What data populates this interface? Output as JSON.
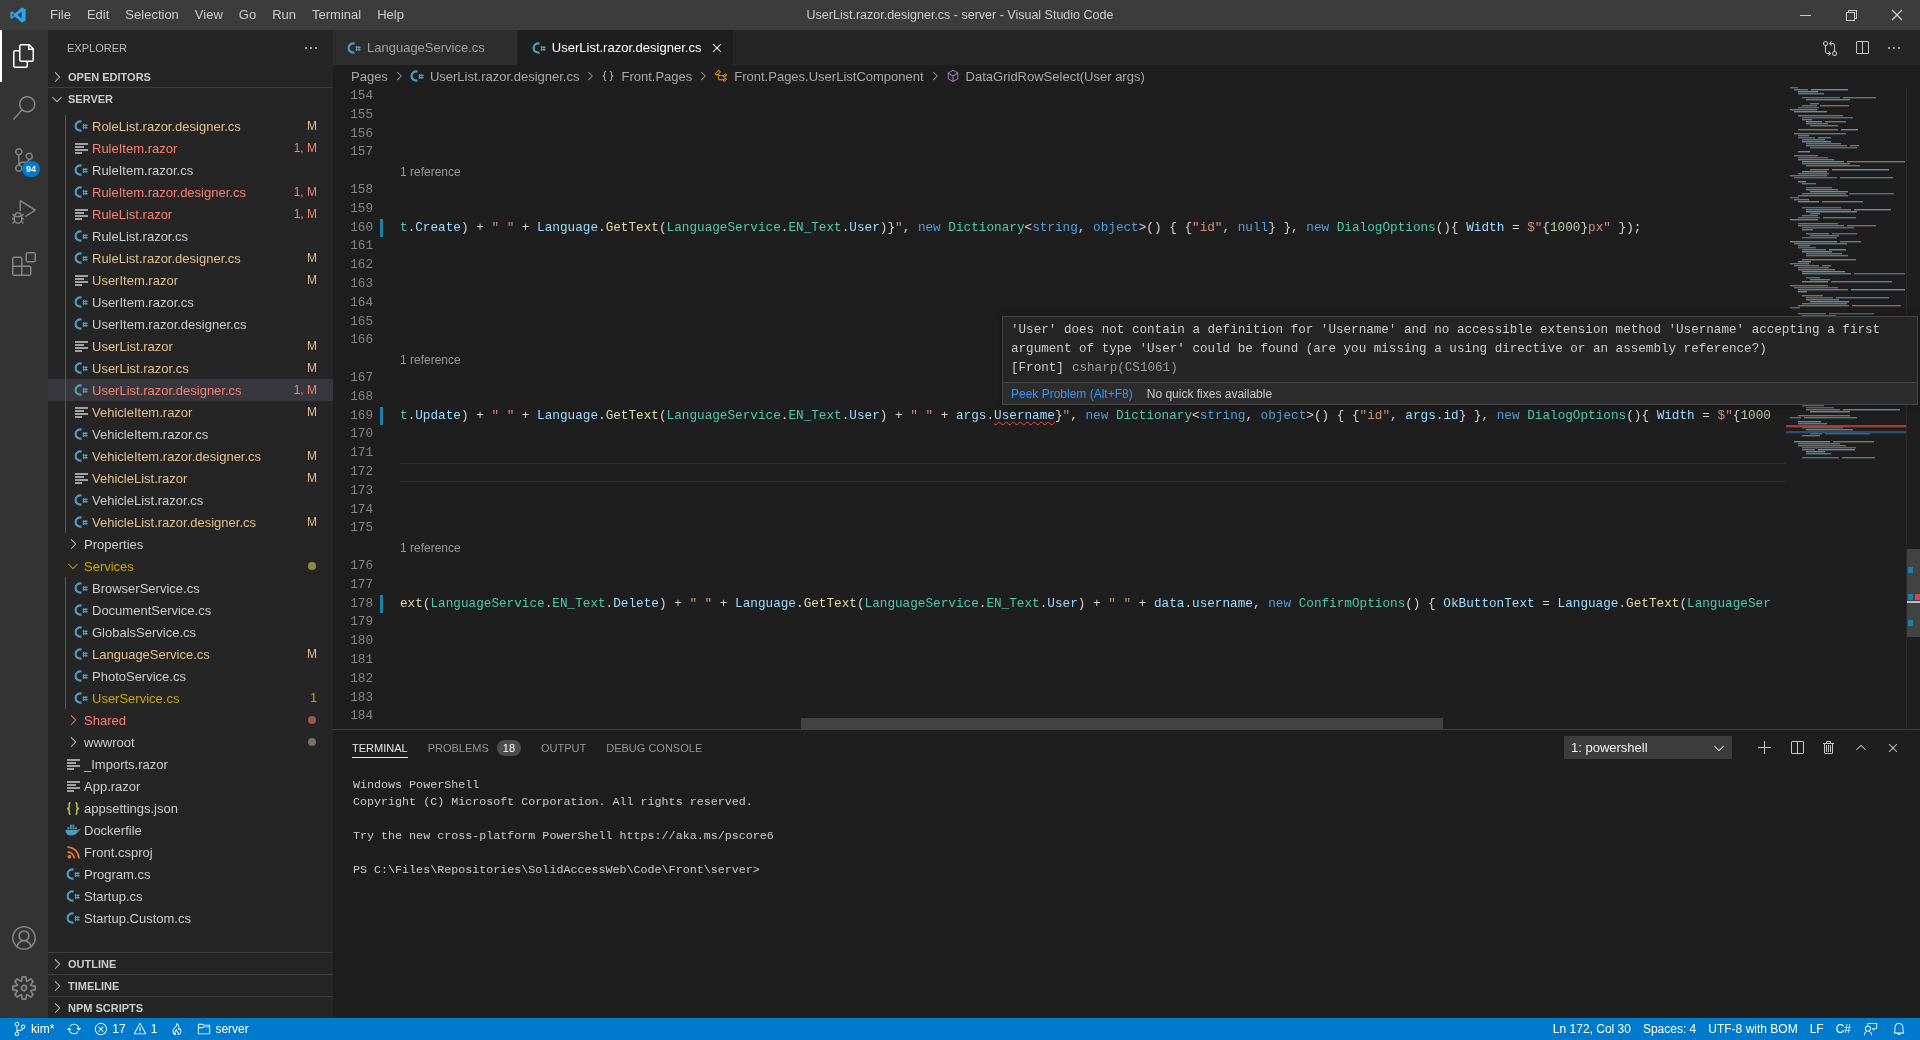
{
  "window": {
    "title": "UserList.razor.designer.cs - server - Visual Studio Code",
    "menu": [
      "File",
      "Edit",
      "Selection",
      "View",
      "Go",
      "Run",
      "Terminal",
      "Help"
    ]
  },
  "activity_bar": {
    "items": [
      {
        "kind": "explorer",
        "selected": true
      },
      {
        "kind": "search",
        "selected": false
      },
      {
        "kind": "source-control",
        "selected": false,
        "badge": "94"
      },
      {
        "kind": "run",
        "selected": false
      },
      {
        "kind": "extensions",
        "selected": false
      }
    ]
  },
  "sidebar": {
    "title": "EXPLORER",
    "sections": [
      {
        "title": "OPEN EDITORS",
        "expanded": false
      },
      {
        "title": "SERVER",
        "expanded": true,
        "tree": [
          {
            "children": [
              {
                "name": "RoleList.razor.designer.cs",
                "kind": "cs",
                "color": "#e2c08d",
                "badge": "M",
                "selected": false
              },
              {
                "name": "RuleItem.razor",
                "kind": "razor",
                "color": "#f88070",
                "badge": "1, M",
                "selected": false
              },
              {
                "name": "RuleItem.razor.cs",
                "kind": "cs",
                "color": "#cccccc",
                "selected": false
              },
              {
                "name": "RuleItem.razor.designer.cs",
                "kind": "cs",
                "color": "#f88070",
                "badge": "1, M",
                "selected": false
              },
              {
                "name": "RuleList.razor",
                "kind": "razor",
                "color": "#f88070",
                "badge": "1, M",
                "selected": false
              },
              {
                "name": "RuleList.razor.cs",
                "kind": "cs",
                "color": "#cccccc",
                "selected": false
              },
              {
                "name": "RuleList.razor.designer.cs",
                "kind": "cs",
                "color": "#e2c08d",
                "badge": "M",
                "selected": false
              },
              {
                "name": "UserItem.razor",
                "kind": "razor",
                "color": "#e2c08d",
                "badge": "M",
                "selected": false
              },
              {
                "name": "UserItem.razor.cs",
                "kind": "cs",
                "color": "#cccccc",
                "selected": false
              },
              {
                "name": "UserItem.razor.designer.cs",
                "kind": "cs",
                "color": "#cccccc",
                "selected": false
              },
              {
                "name": "UserList.razor",
                "kind": "razor",
                "color": "#e2c08d",
                "badge": "M",
                "selected": false
              },
              {
                "name": "UserList.razor.cs",
                "kind": "cs",
                "color": "#e2c08d",
                "badge": "M",
                "selected": false
              },
              {
                "name": "UserList.razor.designer.cs",
                "kind": "cs",
                "color": "#f88070",
                "badge": "1, M",
                "selected": true
              },
              {
                "name": "VehicleItem.razor",
                "kind": "razor",
                "color": "#e2c08d",
                "badge": "M",
                "selected": false
              },
              {
                "name": "VehicleItem.razor.cs",
                "kind": "cs",
                "color": "#cccccc",
                "selected": false
              },
              {
                "name": "VehicleItem.razor.designer.cs",
                "kind": "cs",
                "color": "#e2c08d",
                "badge": "M",
                "selected": false
              },
              {
                "name": "VehicleList.razor",
                "kind": "razor",
                "color": "#e2c08d",
                "badge": "M",
                "selected": false
              },
              {
                "name": "VehicleList.razor.cs",
                "kind": "cs",
                "color": "#cccccc",
                "selected": false
              },
              {
                "name": "VehicleList.razor.designer.cs",
                "kind": "cs",
                "color": "#e2c08d",
                "badge": "M",
                "selected": false
              }
            ]
          },
          {
            "name": "Properties",
            "kind": "folder",
            "expanded": false,
            "color": "#cccccc",
            "selected": false
          },
          {
            "name": "Services",
            "kind": "folder",
            "expanded": true,
            "color": "#cca700",
            "dot": {
              "color": "#8f8a3c"
            },
            "selected": false,
            "children": [
              {
                "name": "BrowserService.cs",
                "kind": "cs",
                "color": "#cccccc",
                "selected": false
              },
              {
                "name": "DocumentService.cs",
                "kind": "cs",
                "color": "#cccccc",
                "selected": false
              },
              {
                "name": "GlobalsService.cs",
                "kind": "cs",
                "color": "#cccccc",
                "selected": false
              },
              {
                "name": "LanguageService.cs",
                "kind": "cs",
                "color": "#e2c08d",
                "badge": "M",
                "selected": false
              },
              {
                "name": "PhotoService.cs",
                "kind": "cs",
                "color": "#cccccc",
                "selected": false
              },
              {
                "name": "UserService.cs",
                "kind": "cs",
                "color": "#cca700",
                "badge": "1",
                "selected": false
              }
            ]
          },
          {
            "name": "Shared",
            "kind": "folder",
            "expanded": false,
            "color": "#f88070",
            "dot": {
              "color": "#a0524d"
            },
            "selected": false
          },
          {
            "name": "wwwroot",
            "kind": "folder",
            "expanded": false,
            "color": "#cccccc",
            "dot": {
              "color": "#7b6e5c"
            },
            "selected": false
          },
          {
            "name": "_Imports.razor",
            "kind": "razor",
            "color": "#cccccc",
            "selected": false
          },
          {
            "name": "App.razor",
            "kind": "razor",
            "color": "#cccccc",
            "selected": false
          },
          {
            "name": "appsettings.json",
            "kind": "json",
            "color": "#cccccc",
            "selected": false
          },
          {
            "name": "Dockerfile",
            "kind": "docker",
            "color": "#cccccc",
            "selected": false
          },
          {
            "name": "Front.csproj",
            "kind": "csproj",
            "color": "#cccccc",
            "selected": false
          },
          {
            "name": "Program.cs",
            "kind": "cs",
            "color": "#cccccc",
            "selected": false
          },
          {
            "name": "Startup.cs",
            "kind": "cs",
            "color": "#cccccc",
            "selected": false
          },
          {
            "name": "Startup.Custom.cs",
            "kind": "cs",
            "color": "#cccccc",
            "selected": false
          }
        ]
      },
      {
        "title": "OUTLINE",
        "expanded": false
      },
      {
        "title": "TIMELINE",
        "expanded": false
      },
      {
        "title": "NPM SCRIPTS",
        "expanded": false
      }
    ]
  },
  "editor": {
    "tabs": [
      {
        "label": "LanguageService.cs",
        "kind": "cs",
        "selected": false
      },
      {
        "label": "UserList.razor.designer.cs",
        "kind": "cs",
        "selected": true
      }
    ],
    "breadcrumbs": [
      {
        "label": "Pages",
        "kind": "folder"
      },
      {
        "label": "UserList.razor.designer.cs",
        "kind": "cs"
      },
      {
        "label": "Front.Pages",
        "kind": "namespace"
      },
      {
        "label": "Front.Pages.UserListComponent",
        "kind": "class"
      },
      {
        "label": "DataGridRowSelect(User args)",
        "kind": "method"
      }
    ],
    "lines": [
      {
        "kind": "code",
        "number": "154",
        "modified": false,
        "current": false
      },
      {
        "kind": "code",
        "number": "155",
        "modified": false,
        "current": false
      },
      {
        "kind": "code",
        "number": "156",
        "modified": false,
        "current": false
      },
      {
        "kind": "code",
        "number": "157",
        "modified": false,
        "current": false
      },
      {
        "kind": "lens",
        "text": "1 reference"
      },
      {
        "kind": "code",
        "number": "158",
        "modified": false,
        "current": false
      },
      {
        "kind": "code",
        "number": "159",
        "modified": false,
        "current": false
      },
      {
        "kind": "code",
        "number": "160",
        "modified": true,
        "current": false,
        "tokens": [
          {
            "text": "t",
            "kind": "type"
          },
          {
            "text": ".",
            "kind": "plain"
          },
          {
            "text": "Create",
            "kind": "variable"
          },
          {
            "text": ") + ",
            "kind": "plain"
          },
          {
            "text": "\" \"",
            "kind": "string"
          },
          {
            "text": " + ",
            "kind": "plain"
          },
          {
            "text": "Language",
            "kind": "variable"
          },
          {
            "text": ".",
            "kind": "plain"
          },
          {
            "text": "GetText",
            "kind": "method"
          },
          {
            "text": "(",
            "kind": "plain"
          },
          {
            "text": "LanguageService",
            "kind": "type"
          },
          {
            "text": ".",
            "kind": "plain"
          },
          {
            "text": "EN_Text",
            "kind": "type"
          },
          {
            "text": ".",
            "kind": "plain"
          },
          {
            "text": "User",
            "kind": "variable"
          },
          {
            "text": ")}",
            "kind": "plain"
          },
          {
            "text": "\"",
            "kind": "string"
          },
          {
            "text": ", ",
            "kind": "plain"
          },
          {
            "text": "new ",
            "kind": "keyword"
          },
          {
            "text": "Dictionary",
            "kind": "type"
          },
          {
            "text": "<",
            "kind": "plain"
          },
          {
            "text": "string",
            "kind": "keyword"
          },
          {
            "text": ", ",
            "kind": "plain"
          },
          {
            "text": "object",
            "kind": "keyword"
          },
          {
            "text": ">() { {",
            "kind": "plain"
          },
          {
            "text": "\"id\"",
            "kind": "string"
          },
          {
            "text": ", ",
            "kind": "plain"
          },
          {
            "text": "null",
            "kind": "keyword"
          },
          {
            "text": "} }, ",
            "kind": "plain"
          },
          {
            "text": "new ",
            "kind": "keyword"
          },
          {
            "text": "DialogOptions",
            "kind": "type"
          },
          {
            "text": "(){ ",
            "kind": "plain"
          },
          {
            "text": "Width",
            "kind": "variable"
          },
          {
            "text": " = ",
            "kind": "plain"
          },
          {
            "text": "$\"",
            "kind": "string"
          },
          {
            "text": "{",
            "kind": "plain"
          },
          {
            "text": "1000",
            "kind": "number"
          },
          {
            "text": "}",
            "kind": "plain"
          },
          {
            "text": "px\"",
            "kind": "string"
          },
          {
            "text": " });",
            "kind": "plain"
          }
        ]
      },
      {
        "kind": "code",
        "number": "161",
        "modified": false,
        "current": false
      },
      {
        "kind": "code",
        "number": "162",
        "modified": false,
        "current": false
      },
      {
        "kind": "code",
        "number": "163",
        "modified": false,
        "current": false
      },
      {
        "kind": "code",
        "number": "164",
        "modified": false,
        "current": false
      },
      {
        "kind": "code",
        "number": "165",
        "modified": false,
        "current": false
      },
      {
        "kind": "code",
        "number": "166",
        "modified": false,
        "current": false
      },
      {
        "kind": "lens",
        "text": "1 reference"
      },
      {
        "kind": "code",
        "number": "167",
        "modified": false,
        "current": false
      },
      {
        "kind": "code",
        "number": "168",
        "modified": false,
        "current": false
      },
      {
        "kind": "code",
        "number": "169",
        "modified": true,
        "current": false,
        "tokens": [
          {
            "text": "t",
            "kind": "type"
          },
          {
            "text": ".",
            "kind": "plain"
          },
          {
            "text": "Update",
            "kind": "variable"
          },
          {
            "text": ") + ",
            "kind": "plain"
          },
          {
            "text": "\" \"",
            "kind": "string"
          },
          {
            "text": " + ",
            "kind": "plain"
          },
          {
            "text": "Language",
            "kind": "variable"
          },
          {
            "text": ".",
            "kind": "plain"
          },
          {
            "text": "GetText",
            "kind": "method"
          },
          {
            "text": "(",
            "kind": "plain"
          },
          {
            "text": "LanguageService",
            "kind": "type"
          },
          {
            "text": ".",
            "kind": "plain"
          },
          {
            "text": "EN_Text",
            "kind": "type"
          },
          {
            "text": ".",
            "kind": "plain"
          },
          {
            "text": "User",
            "kind": "variable"
          },
          {
            "text": ") + ",
            "kind": "plain"
          },
          {
            "text": "\" \"",
            "kind": "string"
          },
          {
            "text": " + ",
            "kind": "plain"
          },
          {
            "text": "args",
            "kind": "variable"
          },
          {
            "text": ".",
            "kind": "plain"
          },
          {
            "text": "Username",
            "kind": "error"
          },
          {
            "text": "}",
            "kind": "plain"
          },
          {
            "text": "\"",
            "kind": "string"
          },
          {
            "text": ", ",
            "kind": "plain"
          },
          {
            "text": "new ",
            "kind": "keyword"
          },
          {
            "text": "Dictionary",
            "kind": "type"
          },
          {
            "text": "<",
            "kind": "plain"
          },
          {
            "text": "string",
            "kind": "keyword"
          },
          {
            "text": ", ",
            "kind": "plain"
          },
          {
            "text": "object",
            "kind": "keyword"
          },
          {
            "text": ">() { {",
            "kind": "plain"
          },
          {
            "text": "\"id\"",
            "kind": "string"
          },
          {
            "text": ", ",
            "kind": "plain"
          },
          {
            "text": "args",
            "kind": "variable"
          },
          {
            "text": ".",
            "kind": "plain"
          },
          {
            "text": "id",
            "kind": "variable"
          },
          {
            "text": "} }, ",
            "kind": "plain"
          },
          {
            "text": "new ",
            "kind": "keyword"
          },
          {
            "text": "DialogOptions",
            "kind": "type"
          },
          {
            "text": "(){ ",
            "kind": "plain"
          },
          {
            "text": "Width",
            "kind": "variable"
          },
          {
            "text": " = ",
            "kind": "plain"
          },
          {
            "text": "$\"",
            "kind": "string"
          },
          {
            "text": "{",
            "kind": "plain"
          },
          {
            "text": "1000",
            "kind": "number"
          }
        ]
      },
      {
        "kind": "code",
        "number": "170",
        "modified": false,
        "current": false
      },
      {
        "kind": "code",
        "number": "171",
        "modified": false,
        "current": false
      },
      {
        "kind": "code",
        "number": "172",
        "modified": false,
        "current": true
      },
      {
        "kind": "code",
        "number": "173",
        "modified": false,
        "current": false
      },
      {
        "kind": "code",
        "number": "174",
        "modified": false,
        "current": false
      },
      {
        "kind": "code",
        "number": "175",
        "modified": false,
        "current": false
      },
      {
        "kind": "lens",
        "text": "1 reference"
      },
      {
        "kind": "code",
        "number": "176",
        "modified": false,
        "current": false
      },
      {
        "kind": "code",
        "number": "177",
        "modified": false,
        "current": false
      },
      {
        "kind": "code",
        "number": "178",
        "modified": true,
        "current": false,
        "tokens": [
          {
            "text": "ext",
            "kind": "method"
          },
          {
            "text": "(",
            "kind": "plain"
          },
          {
            "text": "LanguageService",
            "kind": "type"
          },
          {
            "text": ".",
            "kind": "plain"
          },
          {
            "text": "EN_Text",
            "kind": "type"
          },
          {
            "text": ".",
            "kind": "plain"
          },
          {
            "text": "Delete",
            "kind": "variable"
          },
          {
            "text": ") + ",
            "kind": "plain"
          },
          {
            "text": "\" \"",
            "kind": "string"
          },
          {
            "text": " + ",
            "kind": "plain"
          },
          {
            "text": "Language",
            "kind": "variable"
          },
          {
            "text": ".",
            "kind": "plain"
          },
          {
            "text": "GetText",
            "kind": "method"
          },
          {
            "text": "(",
            "kind": "plain"
          },
          {
            "text": "LanguageService",
            "kind": "type"
          },
          {
            "text": ".",
            "kind": "plain"
          },
          {
            "text": "EN_Text",
            "kind": "type"
          },
          {
            "text": ".",
            "kind": "plain"
          },
          {
            "text": "User",
            "kind": "variable"
          },
          {
            "text": ") + ",
            "kind": "plain"
          },
          {
            "text": "\" \"",
            "kind": "string"
          },
          {
            "text": " + ",
            "kind": "plain"
          },
          {
            "text": "data",
            "kind": "variable"
          },
          {
            "text": ".",
            "kind": "plain"
          },
          {
            "text": "username",
            "kind": "variable"
          },
          {
            "text": ", ",
            "kind": "plain"
          },
          {
            "text": "new ",
            "kind": "keyword"
          },
          {
            "text": "ConfirmOptions",
            "kind": "type"
          },
          {
            "text": "() { ",
            "kind": "plain"
          },
          {
            "text": "OkButtonText",
            "kind": "variable"
          },
          {
            "text": " = ",
            "kind": "plain"
          },
          {
            "text": "Language",
            "kind": "variable"
          },
          {
            "text": ".",
            "kind": "plain"
          },
          {
            "text": "GetText",
            "kind": "method"
          },
          {
            "text": "(",
            "kind": "plain"
          },
          {
            "text": "LanguageSer",
            "kind": "type"
          }
        ]
      },
      {
        "kind": "code",
        "number": "179",
        "modified": false,
        "current": false
      },
      {
        "kind": "code",
        "number": "180",
        "modified": false,
        "current": false
      },
      {
        "kind": "code",
        "number": "181",
        "modified": false,
        "current": false
      },
      {
        "kind": "code",
        "number": "182",
        "modified": false,
        "current": false
      },
      {
        "kind": "code",
        "number": "183",
        "modified": false,
        "current": false
      },
      {
        "kind": "code",
        "number": "184",
        "modified": false,
        "current": false
      }
    ],
    "hover": {
      "message": "'User' does not contain a definition for 'Username' and no accessible extension method 'Username' accepting a first argument of type 'User' could be found (are you missing a using directive or an assembly reference?)",
      "source": "[Front]",
      "code": "csharp(CS1061)",
      "actions": [
        {
          "kind": "link",
          "label": "Peek Problem (Alt+F8)"
        },
        {
          "kind": "note",
          "label": "No quick fixes available"
        }
      ]
    }
  },
  "panel": {
    "tabs": [
      {
        "label": "TERMINAL",
        "selected": true
      },
      {
        "label": "PROBLEMS",
        "selected": false,
        "badge": "18"
      },
      {
        "label": "OUTPUT",
        "selected": false
      },
      {
        "label": "DEBUG CONSOLE",
        "selected": false
      }
    ],
    "terminal_select": {
      "value": "1: powershell"
    },
    "terminal": {
      "blocks": [
        [
          "Windows PowerShell",
          "Copyright (C) Microsoft Corporation. All rights reserved."
        ],
        [
          "Try the new cross-platform PowerShell https://aka.ms/pscore6"
        ],
        [
          "PS C:\\Files\\Repositories\\SolidAccessWeb\\Code\\Front\\server>"
        ]
      ]
    }
  },
  "status_bar": {
    "left": [
      {
        "kind": "branch",
        "text": "kim*"
      },
      {
        "kind": "sync"
      },
      {
        "kind": "problems",
        "errors": "17",
        "warnings": "1"
      },
      {
        "kind": "flame"
      },
      {
        "kind": "folder",
        "text": "server"
      }
    ],
    "right": [
      {
        "kind": "position",
        "text": "Ln 172, Col 30"
      },
      {
        "kind": "indent",
        "text": "Spaces: 4"
      },
      {
        "kind": "encoding",
        "text": "UTF-8 with BOM"
      },
      {
        "kind": "eol",
        "text": "LF"
      },
      {
        "kind": "language",
        "text": "C#"
      },
      {
        "kind": "feedback"
      },
      {
        "kind": "notifications"
      }
    ]
  }
}
